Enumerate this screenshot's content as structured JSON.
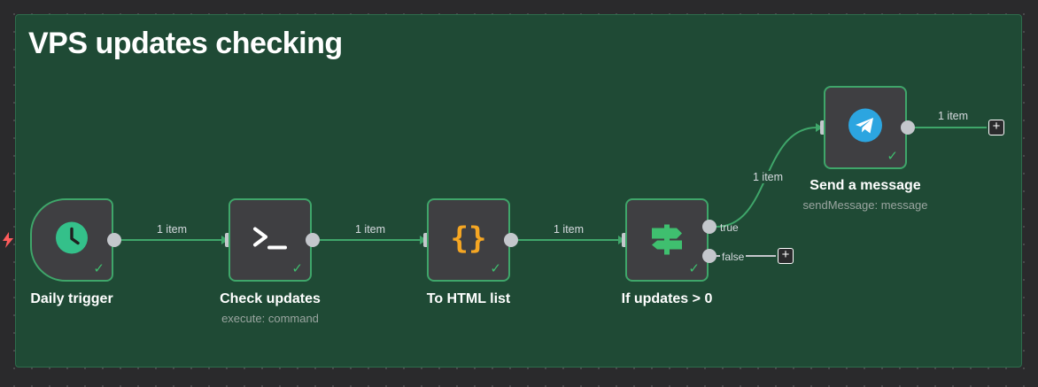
{
  "canvas": {
    "group_title": "VPS updates checking"
  },
  "nodes": {
    "daily_trigger": {
      "label": "Daily trigger",
      "icon": "clock-icon"
    },
    "check_updates": {
      "label": "Check updates",
      "sublabel": "execute: command",
      "icon": "terminal-icon"
    },
    "to_html_list": {
      "label": "To HTML list",
      "icon": "code-braces-icon"
    },
    "if_updates": {
      "label": "If updates > 0",
      "icon": "signpost-icon",
      "true_label": "true",
      "false_label": "false"
    },
    "send_message": {
      "label": "Send a message",
      "sublabel": "sendMessage: message",
      "icon": "telegram-icon"
    }
  },
  "edges": {
    "e1": "1 item",
    "e2": "1 item",
    "e3": "1 item",
    "e4": "1 item",
    "e5": "1 item"
  },
  "colors": {
    "group_bg": "#1f4a35",
    "node_border": "#3fa66a",
    "edge": "#3fa66a",
    "success": "#3fbf6f",
    "telegram": "#2ca5e0",
    "code": "#f5a623"
  }
}
